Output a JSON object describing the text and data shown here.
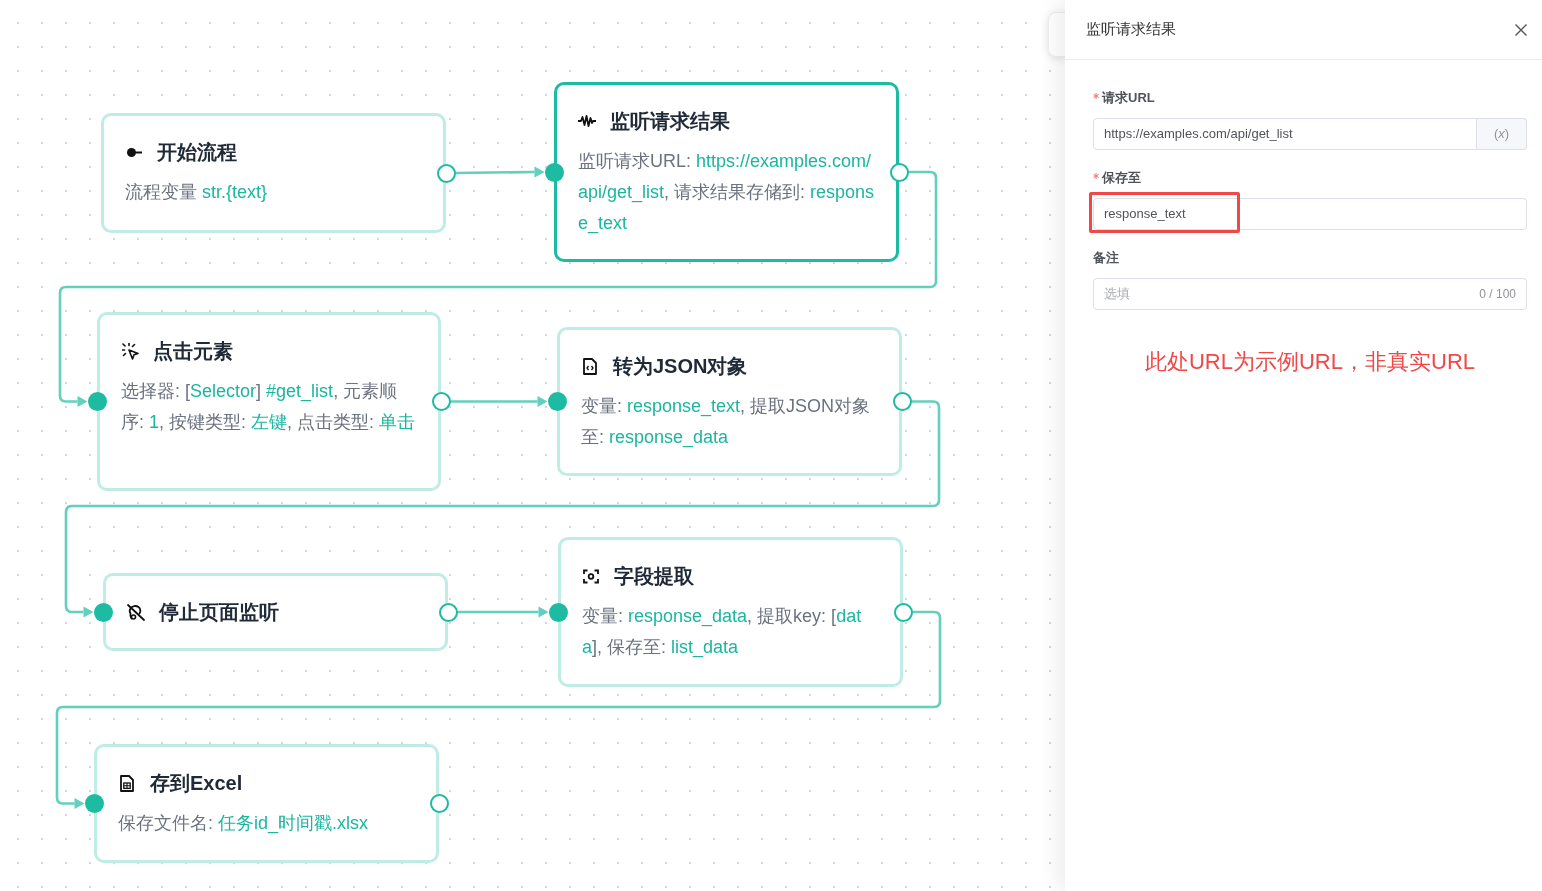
{
  "canvas": {
    "nodes": [
      {
        "kind": "start",
        "title": "开始流程",
        "selected": false,
        "description": [
          {
            "kind": "label",
            "text": "流程变量 "
          },
          {
            "kind": "value",
            "text": "str.{text}"
          }
        ]
      },
      {
        "kind": "listen",
        "title": "监听请求结果",
        "selected": true,
        "description": [
          {
            "kind": "label",
            "text": "监听请求URL: "
          },
          {
            "kind": "value",
            "text": "https://examples.com/api/get_list"
          },
          {
            "kind": "label",
            "text": ", 请求结果存储到: "
          },
          {
            "kind": "value",
            "text": "response_text"
          }
        ]
      },
      {
        "kind": "click",
        "title": "点击元素",
        "selected": false,
        "description": [
          {
            "kind": "label",
            "text": "选择器: ["
          },
          {
            "kind": "value",
            "text": "Selector"
          },
          {
            "kind": "label",
            "text": "] "
          },
          {
            "kind": "value",
            "text": "#get_list"
          },
          {
            "kind": "label",
            "text": ", 元素顺序: "
          },
          {
            "kind": "value",
            "text": "1"
          },
          {
            "kind": "label",
            "text": ", 按键类型: "
          },
          {
            "kind": "value",
            "text": "左键"
          },
          {
            "kind": "label",
            "text": ", 点击类型: "
          },
          {
            "kind": "value",
            "text": "单击"
          }
        ]
      },
      {
        "kind": "parse",
        "title": "转为JSON对象",
        "selected": false,
        "description": [
          {
            "kind": "label",
            "text": "变量: "
          },
          {
            "kind": "value",
            "text": "response_text"
          },
          {
            "kind": "label",
            "text": ", 提取JSON对象至: "
          },
          {
            "kind": "value",
            "text": "response_data"
          }
        ]
      },
      {
        "kind": "unlisten",
        "title": "停止页面监听",
        "selected": false
      },
      {
        "kind": "extract",
        "title": "字段提取",
        "selected": false,
        "description": [
          {
            "kind": "label",
            "text": "变量: "
          },
          {
            "kind": "value",
            "text": "response_data"
          },
          {
            "kind": "label",
            "text": ", 提取key: ["
          },
          {
            "kind": "value",
            "text": "data"
          },
          {
            "kind": "label",
            "text": "], 保存至: "
          },
          {
            "kind": "value",
            "text": "list_data"
          }
        ]
      },
      {
        "kind": "export",
        "title": "存到Excel",
        "selected": false,
        "description": [
          {
            "kind": "label",
            "text": "保存文件名: "
          },
          {
            "kind": "value",
            "text": "任务id_时间戳.xlsx"
          }
        ]
      }
    ]
  },
  "drawer": {
    "title": "监听请求结果",
    "fields": [
      {
        "kind": "variable",
        "label": "请求URL",
        "required": true,
        "highlighted": false,
        "value": "https://examples.com/api/get_list",
        "addon": "(*x*)"
      },
      {
        "kind": "text",
        "label": "保存至",
        "required": true,
        "highlighted": true,
        "value": "response_text"
      },
      {
        "kind": "counter",
        "label": "备注",
        "required": false,
        "highlighted": false,
        "placeholder": "选填",
        "counter": "0 / 100"
      }
    ],
    "note": "此处URL为示例URL，非真实URL"
  }
}
